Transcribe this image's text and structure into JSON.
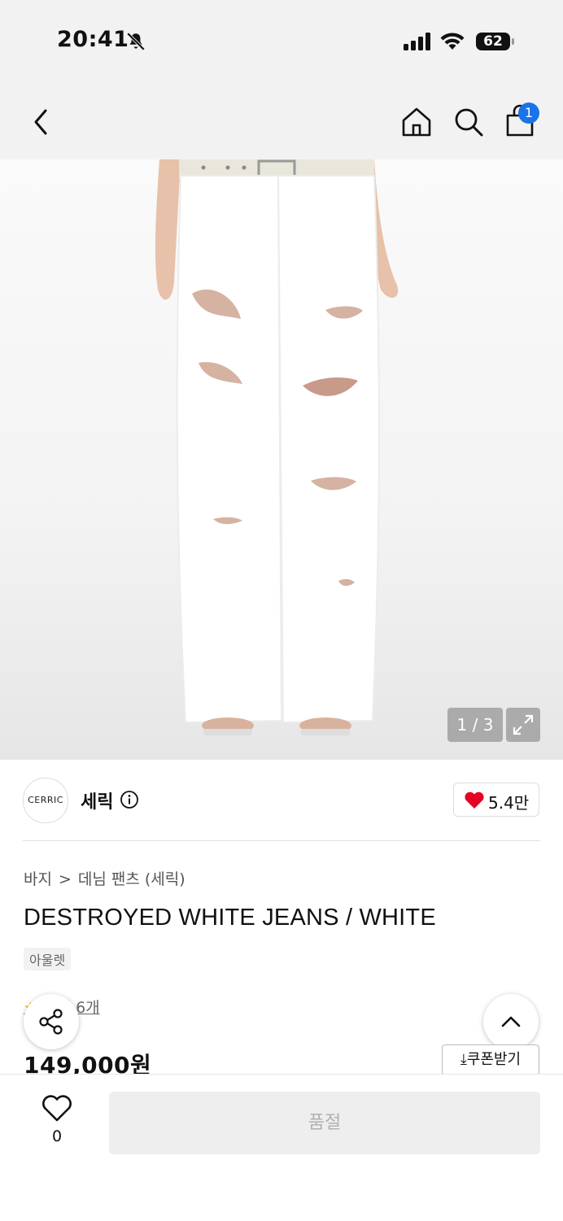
{
  "status": {
    "time": "20:41",
    "battery": "62"
  },
  "nav": {
    "cart_count": "1"
  },
  "gallery": {
    "counter": "1 / 3"
  },
  "brand": {
    "logo_text": "CERRIC",
    "name": "세릭",
    "likes": "5.4만"
  },
  "breadcrumb": {
    "level1": "바지",
    "separator": ">",
    "level2": "데님 팬츠 (세릭)"
  },
  "product": {
    "title": "DESTROYED WHITE JEANS / WHITE",
    "tag": "아울렛",
    "review_text": "후기 6개",
    "price": "149,000원",
    "coupon_label": "쿠폰받기"
  },
  "bottom": {
    "wish_count": "0",
    "buy_label": "품절"
  },
  "colors": {
    "accent_blue": "#1a73e8",
    "heart_red": "#e60023"
  }
}
